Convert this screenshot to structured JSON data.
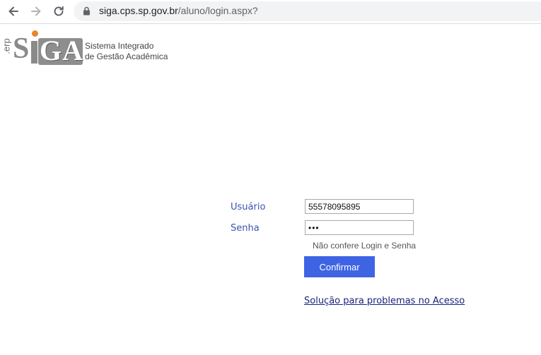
{
  "browser": {
    "url_host": "siga.cps.sp.gov.br",
    "url_path": "/aluno/login.aspx?"
  },
  "logo": {
    "erp": ".erp",
    "s": "S",
    "ga": "GA",
    "tagline_line1": "Sistema Integrado",
    "tagline_line2": "de Gestão Acadêmica"
  },
  "login": {
    "user_label": "Usuário",
    "user_value": "55578095895",
    "password_label": "Senha",
    "password_value": "•••",
    "error_message": "Não confere Login e Senha",
    "confirm_button": "Confirmar",
    "help_link": "Solução para problemas no Acesso"
  },
  "colors": {
    "label": "#3a53b4",
    "button": "#3e64e4",
    "logo_dot": "#e8852f"
  }
}
